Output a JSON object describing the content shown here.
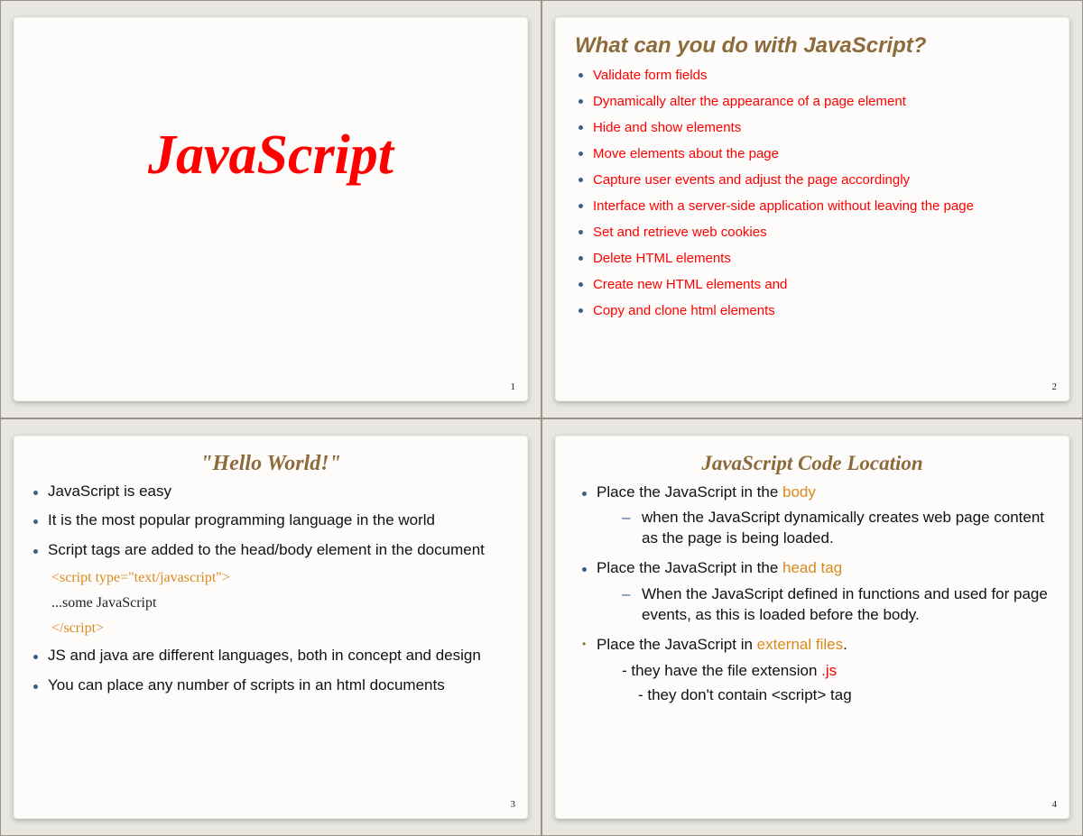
{
  "slide1": {
    "title": "JavaScript",
    "pagenum": "1"
  },
  "slide2": {
    "title": "What can you do with JavaScript?",
    "items": [
      "Validate form fields",
      "Dynamically alter the appearance of a page element",
      "Hide and show elements",
      "Move elements about the page",
      "Capture user events and adjust the page accordingly",
      "Interface with a server-side application without leaving the page",
      "Set and retrieve web cookies",
      "Delete HTML elements",
      "Create new HTML elements and",
      "Copy and clone html elements"
    ],
    "pagenum": "2"
  },
  "slide3": {
    "title": "\"Hello World!\"",
    "items_top": [
      "JavaScript is easy",
      "It is the most popular programming language in the world",
      "Script tags are added to the head/body element in the document"
    ],
    "code": {
      "open": "<script type=\"text/javascript\">",
      "body": "...some JavaScript",
      "close": "</script>"
    },
    "items_bottom": [
      "JS and java are different languages, both in concept and design",
      "You can place any number of scripts in an html documents"
    ],
    "pagenum": "3"
  },
  "slide4": {
    "title": "JavaScript Code Location",
    "row1": {
      "prefix": "Place the JavaScript in the ",
      "hl": "body"
    },
    "sub1": "when the JavaScript dynamically creates web page content as the page is being loaded.",
    "row2": {
      "prefix": "Place the JavaScript in the ",
      "hl": "head tag"
    },
    "sub2": "When the JavaScript defined in functions and used for page events, as this is loaded before the body.",
    "row3": {
      "prefix": "Place the JavaScript in ",
      "hl": "external files",
      "suffix": "."
    },
    "sub3a": {
      "prefix": "- they have the file extension ",
      "hl": ".js"
    },
    "sub3b": "- they don't contain <script> tag",
    "pagenum": "4"
  }
}
